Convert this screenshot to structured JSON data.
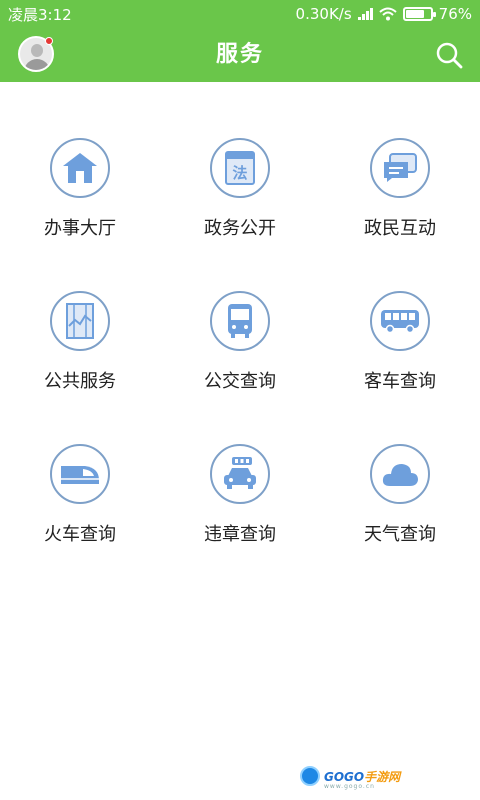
{
  "status_bar": {
    "time": "凌晨3:12",
    "net_speed": "0.30K/s",
    "battery_percent": "76%",
    "battery_level": 0.76
  },
  "header": {
    "title": "服务",
    "avatar_icon": "user-avatar-icon",
    "search_icon": "search-icon",
    "bg_color": "#6ac64a"
  },
  "services": [
    {
      "label": "办事大厅",
      "icon": "house-icon"
    },
    {
      "label": "政务公开",
      "icon": "law-book-icon"
    },
    {
      "label": "政民互动",
      "icon": "chat-bubble-icon"
    },
    {
      "label": "公共服务",
      "icon": "chart-document-icon"
    },
    {
      "label": "公交查询",
      "icon": "bus-front-icon"
    },
    {
      "label": "客车查询",
      "icon": "coach-bus-icon"
    },
    {
      "label": "火车查询",
      "icon": "train-icon"
    },
    {
      "label": "违章查询",
      "icon": "car-plate-icon"
    },
    {
      "label": "天气查询",
      "icon": "cloud-icon"
    }
  ],
  "watermark": {
    "brand_a": "GOGO",
    "brand_b": "手游网",
    "domain": "www.gogo.cn"
  }
}
